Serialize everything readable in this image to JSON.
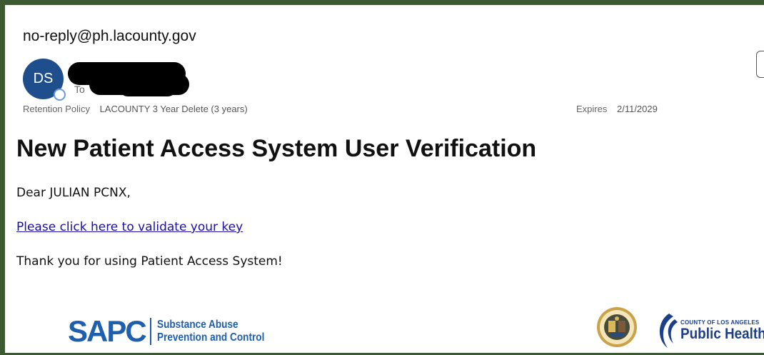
{
  "email": {
    "sender_address": "no-reply@ph.lacounty.gov",
    "avatar_initials": "DS",
    "to_label": "To",
    "retention_label": "Retention Policy",
    "retention_value": "LACOUNTY 3 Year Delete (3 years)",
    "expires_label": "Expires",
    "expires_value": "2/11/2029",
    "subject": "New Patient Access System User Verification",
    "greeting": "Dear JULIAN PCNX,",
    "link_text": "Please click here to validate your key",
    "closing": "Thank you for using Patient Access System!"
  },
  "footer": {
    "sapc_mark": "SAPC",
    "sapc_line1": "Substance Abuse",
    "sapc_line2": "Prevention and Control",
    "ph_small": "COUNTY OF LOS ANGELES",
    "ph_big": "Public Health"
  },
  "colors": {
    "frame": "#3d5a33",
    "avatar": "#1e4f8c",
    "link": "#1a0dab",
    "logo_blue": "#1f5fb0"
  }
}
